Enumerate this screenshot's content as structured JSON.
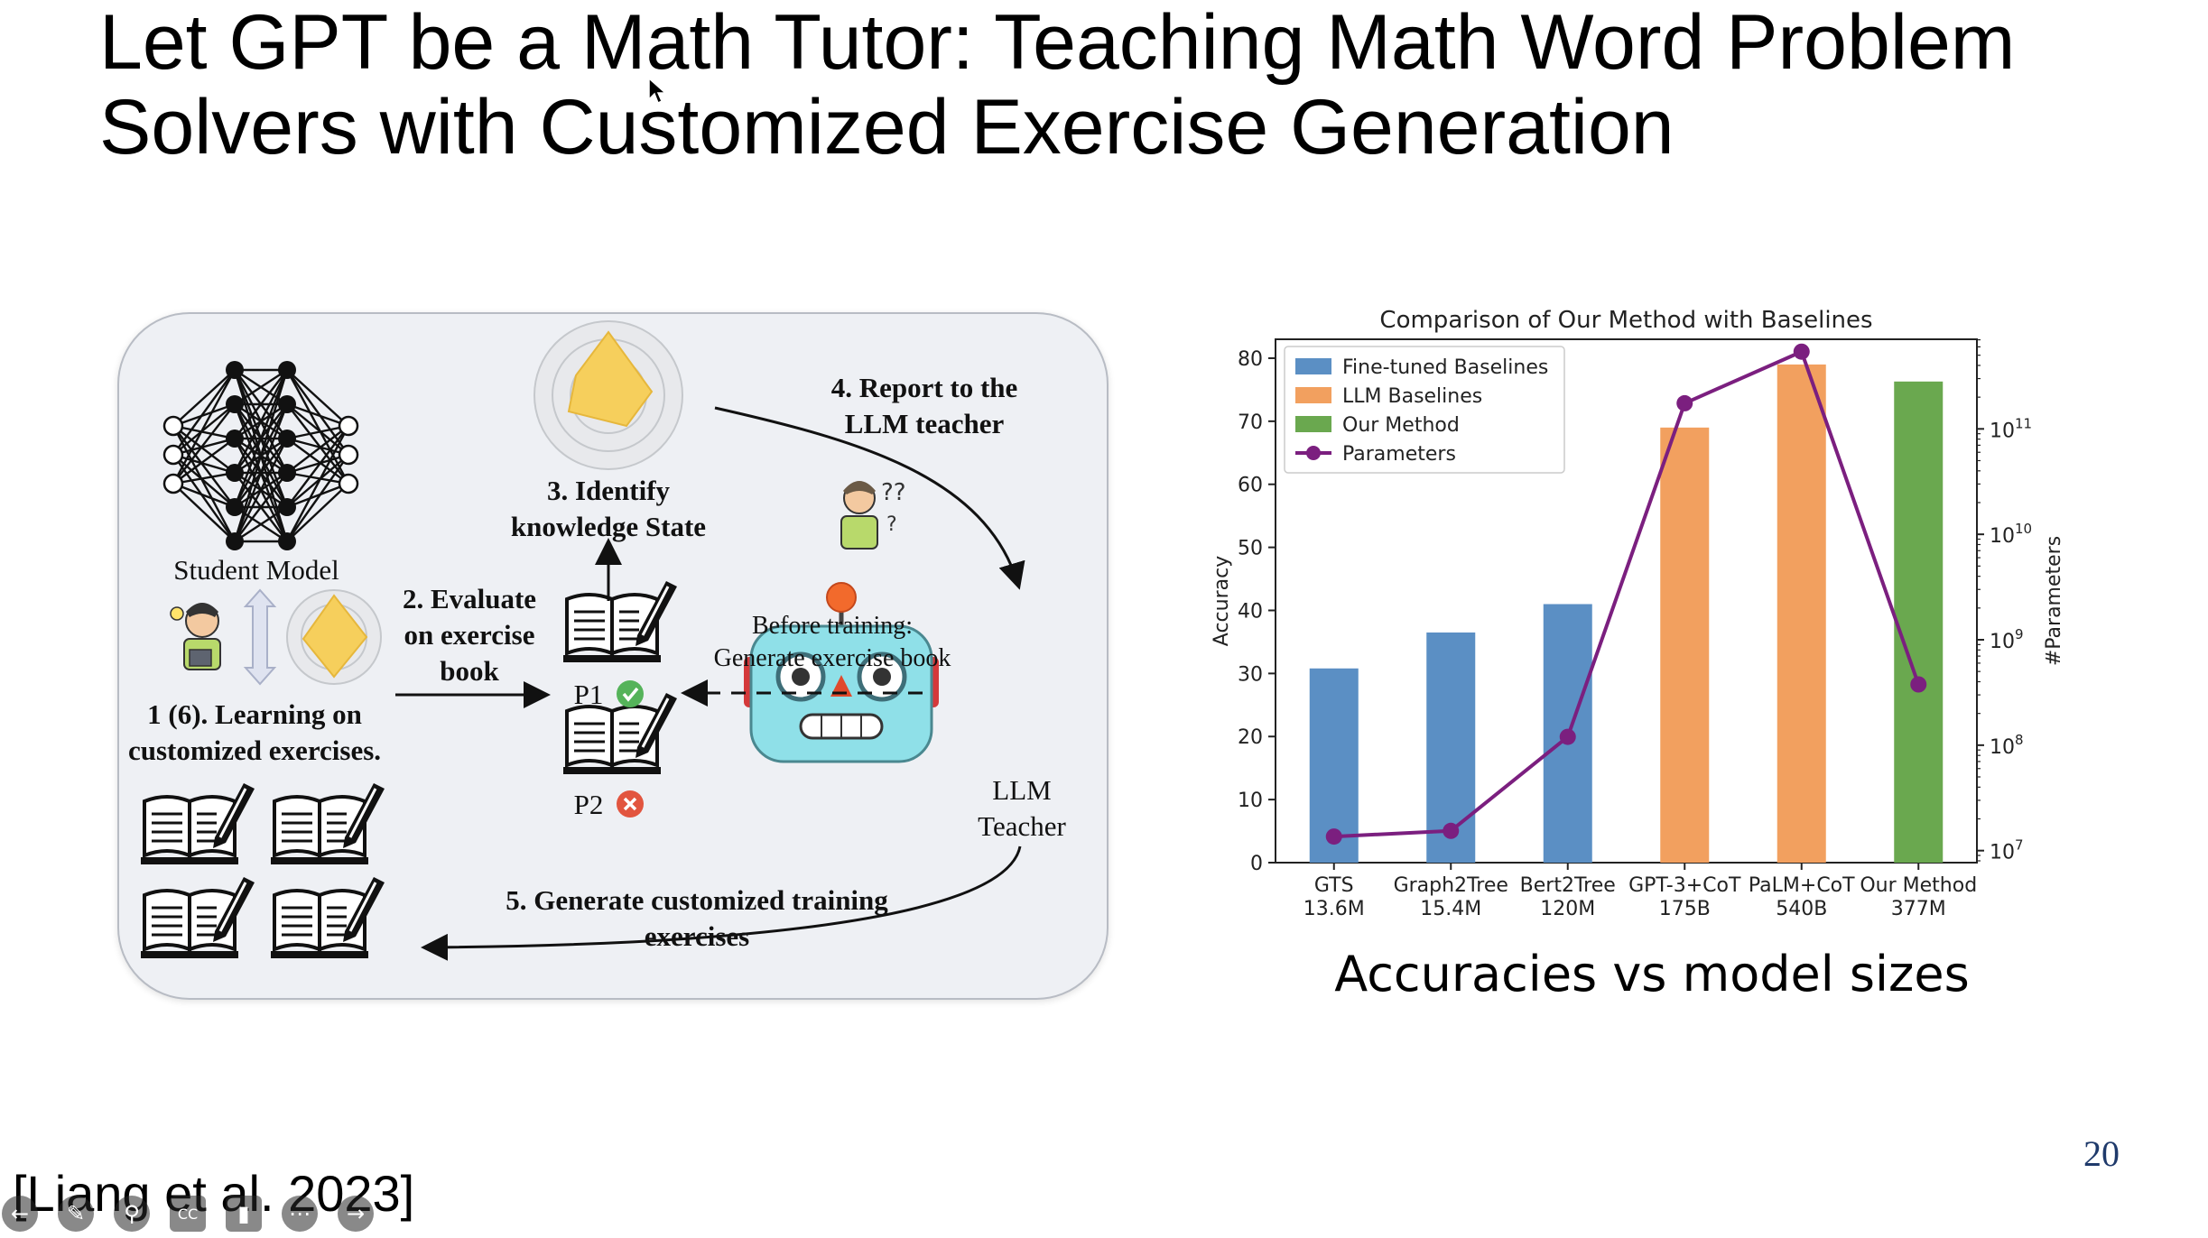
{
  "slide": {
    "title_line1": "Let GPT be a Math Tutor: Teaching Math Word Problem",
    "title_line2": "Solvers with Customized Exercise Generation",
    "citation": "[Liang et al. 2023]",
    "page_number": "20",
    "caption": "Accuracies vs model sizes"
  },
  "diagram": {
    "student_model": "Student Model",
    "step1_line1": "1 (6). Learning on",
    "step1_line2": "customized exercises.",
    "step2_line1": "2. Evaluate",
    "step2_line2": "on exercise",
    "step2_line3": "book",
    "step3_line1": "3. Identify",
    "step3_line2": "knowledge State",
    "step4_line1": "4. Report to the",
    "step4_line2": "LLM teacher",
    "before_line1": "Before training:",
    "before_line2": "Generate exercise book",
    "p1": "P1",
    "p2": "P2",
    "teacher_line1": "LLM",
    "teacher_line2": "Teacher",
    "step5_line1": "5. Generate customized training",
    "step5_line2": "exercises"
  },
  "chart_data": {
    "type": "bar",
    "title": "Comparison of Our Method with Baselines",
    "ylabel": "Accuracy",
    "y2label": "#Parameters",
    "ylim": [
      0,
      83
    ],
    "y_ticks": [
      0,
      10,
      20,
      30,
      40,
      50,
      60,
      70,
      80
    ],
    "y2_scale": "log",
    "y2_ticks": [
      "10^7",
      "10^8",
      "10^9",
      "10^10",
      "10^11"
    ],
    "categories": [
      "GTS\n13.6M",
      "Graph2Tree\n15.4M",
      "Bert2Tree\n120M",
      "GPT-3+CoT\n175B",
      "PaLM+CoT\n540B",
      "Our Method\n377M"
    ],
    "series": [
      {
        "name": "Fine-tuned Baselines",
        "color": "#5b8fc4",
        "values": [
          30.8,
          36.5,
          41.0,
          null,
          null,
          null
        ]
      },
      {
        "name": "LLM Baselines",
        "color": "#f2a05f",
        "values": [
          null,
          null,
          null,
          69.0,
          79.0,
          null
        ]
      },
      {
        "name": "Our Method",
        "color": "#6aa84f",
        "values": [
          null,
          null,
          null,
          null,
          null,
          76.3
        ]
      }
    ],
    "line_series": {
      "name": "Parameters",
      "color": "#7b1f7f",
      "values": [
        13600000,
        15400000,
        120000000,
        175000000000,
        540000000000,
        377000000
      ]
    },
    "legend": "top-left",
    "grid": false
  },
  "toolbar": {
    "icons": [
      "back-arrow-icon",
      "pen-icon",
      "zoom-icon",
      "cc-icon",
      "video-icon",
      "more-icon",
      "forward-arrow-icon"
    ]
  }
}
